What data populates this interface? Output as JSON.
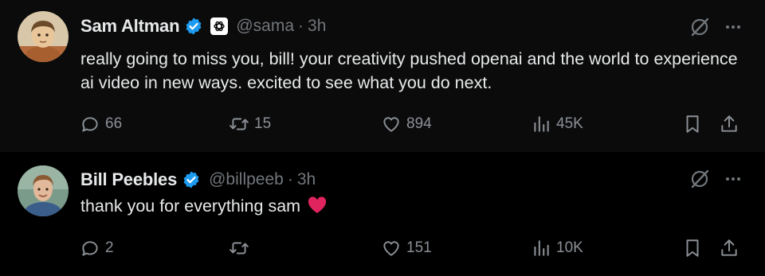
{
  "tweets": [
    {
      "author_name": "Sam Altman",
      "handle": "@sama",
      "separator": "·",
      "time": "3h",
      "text": "really going to miss you, bill! your creativity pushed openai and the world to experience ai video in new ways. excited to see what you do next.",
      "replies": "66",
      "reposts": "15",
      "likes": "894",
      "views": "45K"
    },
    {
      "author_name": "Bill Peebles",
      "handle": "@billpeeb",
      "separator": "·",
      "time": "3h",
      "text": "thank you for everything sam",
      "replies": "2",
      "reposts": "",
      "likes": "151",
      "views": "10K"
    }
  ],
  "icons": {
    "verified": "verified-badge-icon",
    "org": "openai-logo-icon",
    "grok": "grok-icon",
    "more": "more-icon",
    "reply": "reply-icon",
    "repost": "repost-icon",
    "like": "heart-icon",
    "views": "views-icon",
    "bookmark": "bookmark-icon",
    "share": "share-icon",
    "emoji": "red-heart-emoji"
  },
  "colors": {
    "background": "#000000",
    "text": "#e7e9ea",
    "secondary": "#71767b",
    "verified": "#1d9bf0",
    "emoji_heart": "#e0245e"
  }
}
